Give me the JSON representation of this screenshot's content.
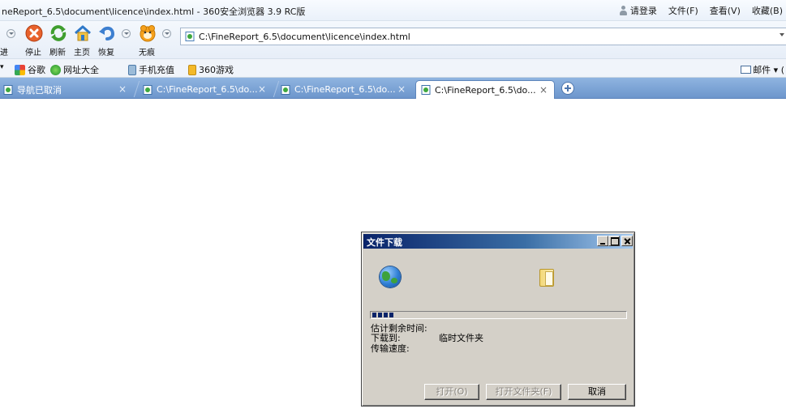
{
  "window": {
    "title": "neReport_6.5\\document\\licence\\index.html - 360安全浏览器 3.9 RC版",
    "login": "请登录",
    "menus": [
      "文件(F)",
      "查看(V)",
      "收藏(B)"
    ]
  },
  "toolbar": {
    "stop_label": "停止",
    "refresh_label": "刷新",
    "home_label": "主页",
    "restore_label": "恢复",
    "incognito_label": "无痕",
    "left_edge_label": "进"
  },
  "address": {
    "url": "C:\\FineReport_6.5\\document\\licence\\index.html"
  },
  "favorites": {
    "items": [
      "谷歌",
      "网址大全",
      "手机充值",
      "360游戏"
    ],
    "mail_label": "邮件"
  },
  "tabs": [
    {
      "label": "导航已取消",
      "active": false
    },
    {
      "label": "C:\\FineReport_6.5\\do...",
      "active": false
    },
    {
      "label": "C:\\FineReport_6.5\\do...",
      "active": false
    },
    {
      "label": "C:\\FineReport_6.5\\do...",
      "active": true
    }
  ],
  "tab_close_glyph": "×",
  "dialog": {
    "title": "文件下载",
    "progress_fraction": 0.09,
    "remaining_label": "估计剩余时间:",
    "download_to_label": "下载到:",
    "download_to_value": "临时文件夹",
    "speed_label": "传输速度:",
    "open_button": "打开(O)",
    "open_folder_button": "打开文件夹(F)",
    "cancel_button": "取消"
  },
  "colors": {
    "tab_strip": "#7ba3d6",
    "dialog_face": "#d4d0c8",
    "dialog_title": "#0a246a"
  }
}
